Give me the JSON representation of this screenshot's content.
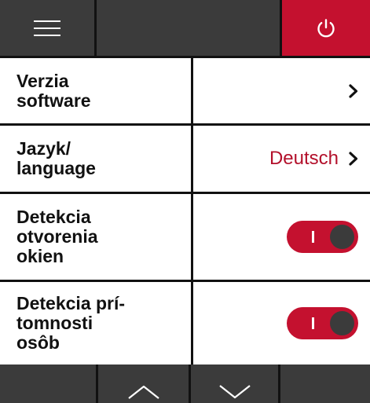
{
  "topbar": {
    "menu_icon": "hamburger-menu-icon",
    "power_icon": "power-icon",
    "accent_color": "#c4112f",
    "bar_color": "#3b3b3b"
  },
  "settings": [
    {
      "label": "Verzia\nsoftware",
      "value": "",
      "control": "chevron"
    },
    {
      "label": "Jazyk/\nlanguage",
      "value": "Deutsch",
      "control": "chevron"
    },
    {
      "label": "Detekcia\notvorenia\nokien",
      "value": "",
      "control": "toggle",
      "toggle_on": true
    },
    {
      "label": "Detekcia prí-\ntomnosti\nosôb",
      "value": "",
      "control": "toggle",
      "toggle_on": true
    }
  ],
  "bottombar": {
    "up_icon": "chevron-up-icon",
    "down_icon": "chevron-down-icon"
  }
}
